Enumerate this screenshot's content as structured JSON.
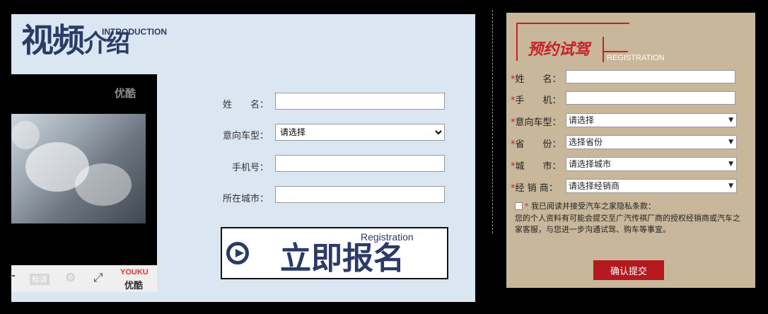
{
  "video_intro": {
    "title_cn": "视频",
    "title_cn_small": "介绍",
    "title_en": "INTRODUCTION",
    "player": {
      "brand": "优酷",
      "quality_label": "标清",
      "logo_en": "YOUKU",
      "logo_cn": "优酷"
    }
  },
  "main_form": {
    "name_label": "姓　　名：",
    "model_label": "意向车型：",
    "model_value": "请选择",
    "phone_label": "手机号：",
    "city_label": "所在城市：",
    "submit_cn": "立即报名",
    "submit_en": "Registration"
  },
  "test_drive": {
    "title_cn": "预约试驾",
    "title_en": "REGISTRATION",
    "star": "*",
    "fields": {
      "name_label": "姓　　名：",
      "phone_label": "手　　机：",
      "model_label": "意向车型：",
      "model_value": "请选择",
      "province_label": "省　　份：",
      "province_value": "选择省份",
      "city_label": "城　　市：",
      "city_value": "请选择城市",
      "dealer_label": "经 销 商：",
      "dealer_value": "请选择经销商"
    },
    "agree_text": "我已阅读并接受汽车之家隐私条款：",
    "notice_line1": "您的个人资料有可能会提交至广汽传祺厂商的授权经销商或汽车之",
    "notice_line2": "家客服，与您进一步沟通试驾、购车等事宜。",
    "submit_label": "确认提交"
  }
}
